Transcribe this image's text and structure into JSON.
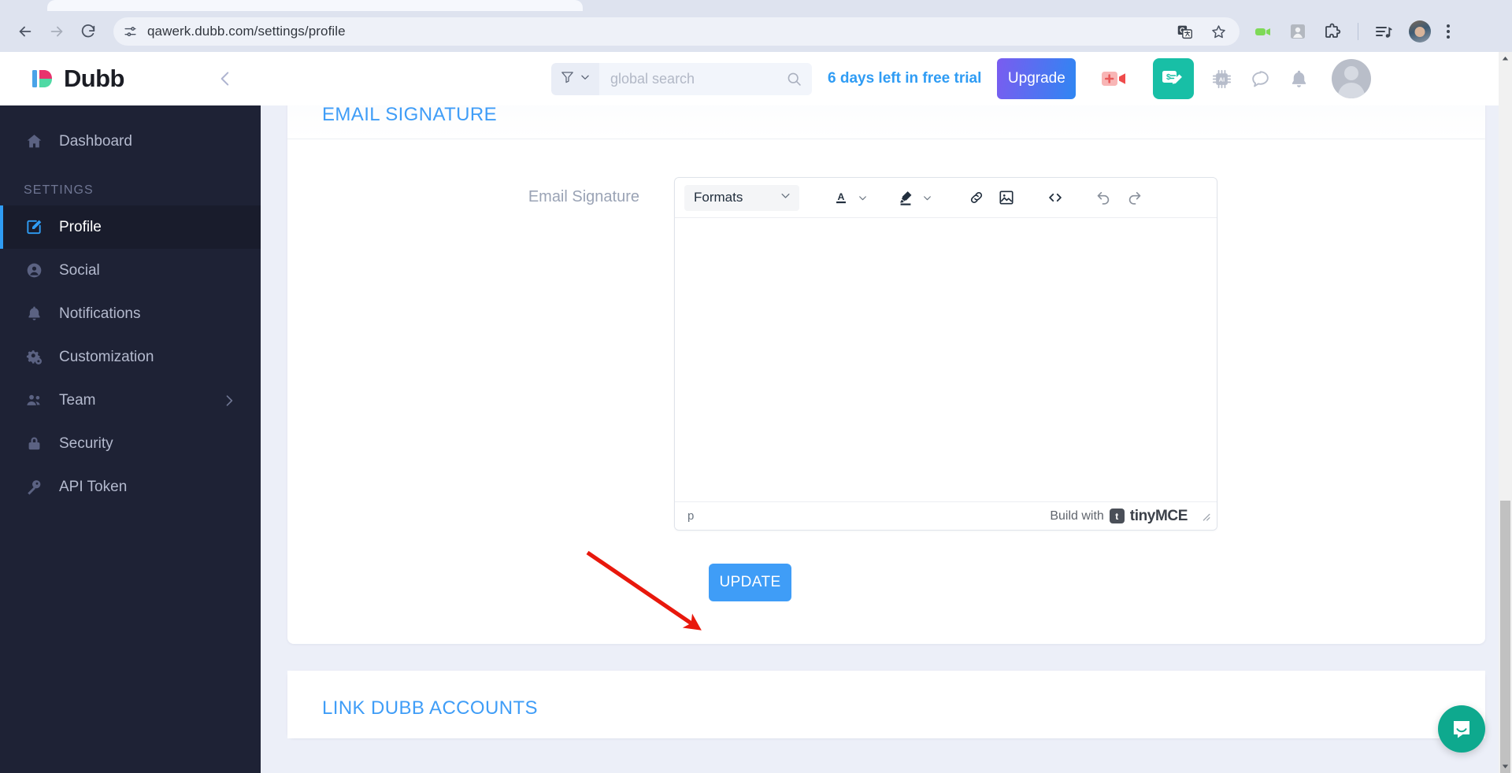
{
  "browser": {
    "url": "qawerk.dubb.com/settings/profile",
    "back_icon": "back-arrow-icon",
    "forward_icon": "forward-arrow-icon",
    "reload_icon": "reload-icon",
    "site_info_icon": "site-settings-icon",
    "translate_icon": "translate-icon",
    "bookmark_icon": "bookmark-star-icon",
    "extensions": [
      {
        "name": "dubb-video-extension-icon"
      },
      {
        "name": "screenshot-extension-icon"
      },
      {
        "name": "extensions-puzzle-icon"
      },
      {
        "name": "media-playlist-icon"
      }
    ],
    "profile_avatar": "browser-profile-avatar",
    "menu_icon": "chrome-menu-kebab-icon"
  },
  "sidebar": {
    "brand": "Dubb",
    "collapse_icon": "chevron-left-icon",
    "section_label": "SETTINGS",
    "items": [
      {
        "label": "Dashboard",
        "icon": "home-icon",
        "active": false
      },
      {
        "label": "Profile",
        "icon": "edit-pencil-icon",
        "active": true
      },
      {
        "label": "Social",
        "icon": "user-circle-icon",
        "active": false
      },
      {
        "label": "Notifications",
        "icon": "bell-icon",
        "active": false
      },
      {
        "label": "Customization",
        "icon": "gears-icon",
        "active": false
      },
      {
        "label": "Team",
        "icon": "people-icon",
        "active": false,
        "chevron": "chevron-right-icon"
      },
      {
        "label": "Security",
        "icon": "lock-icon",
        "active": false
      },
      {
        "label": "API Token",
        "icon": "key-icon",
        "active": false
      }
    ]
  },
  "header": {
    "filter_icon": "filter-funnel-icon",
    "filter_caret": "chevron-down-icon",
    "search_placeholder": "global search",
    "search_value": "",
    "search_icon": "search-magnifier-icon",
    "trial_text": "6 days left in free trial",
    "upgrade_label": "Upgrade",
    "record_icon": "record-video-icon",
    "sign_icon": "sales-page-icon",
    "ai_icon": "ai-chip-icon",
    "chat_icon": "chat-bubble-icon",
    "bell_icon": "bell-icon",
    "avatar": "user-avatar",
    "accent_blue": "#3f9df7",
    "accent_teal": "#18bfa6"
  },
  "main": {
    "card_email_signature": {
      "title": "EMAIL SIGNATURE",
      "field_label": "Email Signature",
      "editor": {
        "format_select": "Formats",
        "format_caret": "chevron-down-icon",
        "tools": [
          {
            "name": "text-color-icon",
            "label": "A"
          },
          {
            "name": "text-color-caret",
            "label": ""
          },
          {
            "name": "highlight-color-icon",
            "label": ""
          },
          {
            "name": "highlight-color-caret",
            "label": ""
          },
          {
            "name": "insert-link-icon",
            "label": ""
          },
          {
            "name": "insert-image-icon",
            "label": ""
          },
          {
            "name": "source-code-icon",
            "label": "<>"
          },
          {
            "name": "undo-icon",
            "label": ""
          },
          {
            "name": "redo-icon",
            "label": ""
          }
        ],
        "content": "",
        "status_path": "p",
        "brand_prefix": "Build with",
        "brand_name": "tinyMCE",
        "resize_icon": "resize-grip-icon"
      },
      "update_label": "UPDATE"
    },
    "card_link_accounts": {
      "title": "LINK DUBB ACCOUNTS"
    }
  },
  "overlay": {
    "annotation_arrow": "red-annotation-arrow",
    "annotation_color": "#e8180c",
    "intercom_label": "intercom-chat-launcher"
  },
  "scrollbar": {
    "up_icon": "scroll-up-arrow",
    "down_icon": "scroll-down-arrow"
  }
}
